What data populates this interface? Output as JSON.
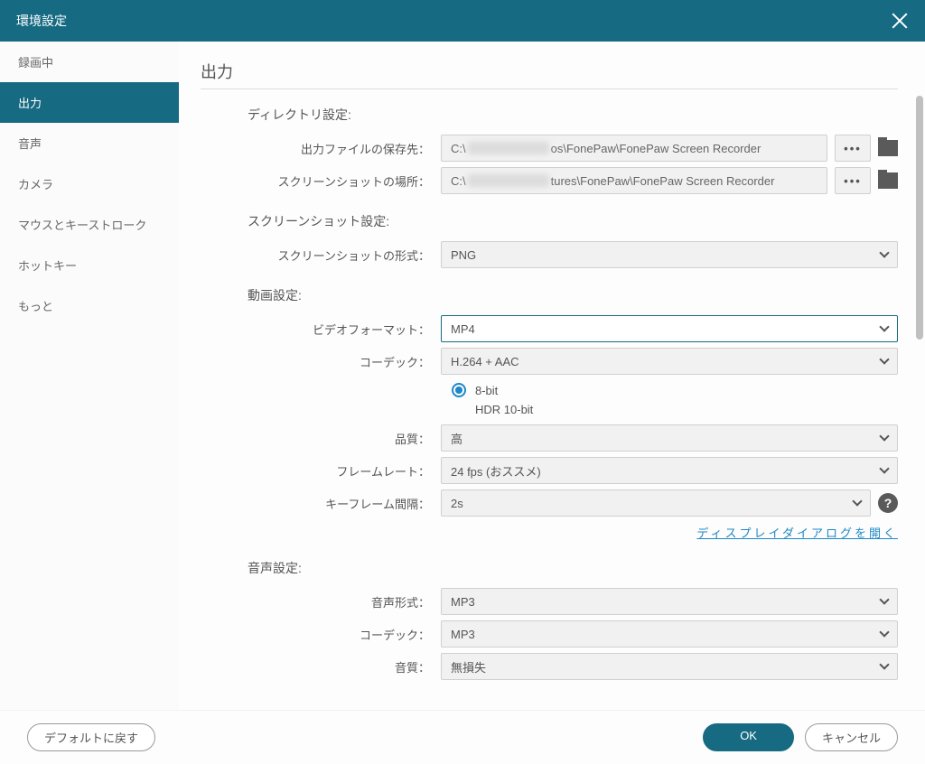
{
  "titlebar": {
    "title": "環境設定"
  },
  "sidebar": {
    "items": [
      {
        "label": "録画中"
      },
      {
        "label": "出力"
      },
      {
        "label": "音声"
      },
      {
        "label": "カメラ"
      },
      {
        "label": "マウスとキーストローク"
      },
      {
        "label": "ホットキー"
      },
      {
        "label": "もっと"
      }
    ],
    "activeIndex": 1
  },
  "page": {
    "title": "出力"
  },
  "directory": {
    "section": "ディレクトリ設定:",
    "output_label": "出力ファイルの保存先：",
    "output_path_prefix": "C:\\",
    "output_path_suffix": "os\\FonePaw\\FonePaw Screen Recorder",
    "screenshot_label": "スクリーンショットの場所：",
    "screenshot_path_prefix": "C:\\",
    "screenshot_path_suffix": "tures\\FonePaw\\FonePaw Screen Recorder",
    "more": "•••"
  },
  "screenshot": {
    "section": "スクリーンショット設定:",
    "format_label": "スクリーンショットの形式：",
    "format_value": "PNG"
  },
  "video": {
    "section": "動画設定:",
    "format_label": "ビデオフォーマット：",
    "format_value": "MP4",
    "codec_label": "コーデック：",
    "codec_value": "H.264 + AAC",
    "bit8": "8-bit",
    "hdr10": "HDR 10-bit",
    "quality_label": "品質：",
    "quality_value": "高",
    "fps_label": "フレームレート：",
    "fps_value": "24 fps (おススメ)",
    "keyframe_label": "キーフレーム間隔：",
    "keyframe_value": "2s",
    "display_link": "ディスプレイダイアログを開く"
  },
  "audio": {
    "section": "音声設定:",
    "format_label": "音声形式：",
    "format_value": "MP3",
    "codec_label": "コーデック：",
    "codec_value": "MP3",
    "quality_label": "音質：",
    "quality_value": "無損失"
  },
  "footer": {
    "reset": "デフォルトに戻す",
    "ok": "OK",
    "cancel": "キャンセル"
  }
}
